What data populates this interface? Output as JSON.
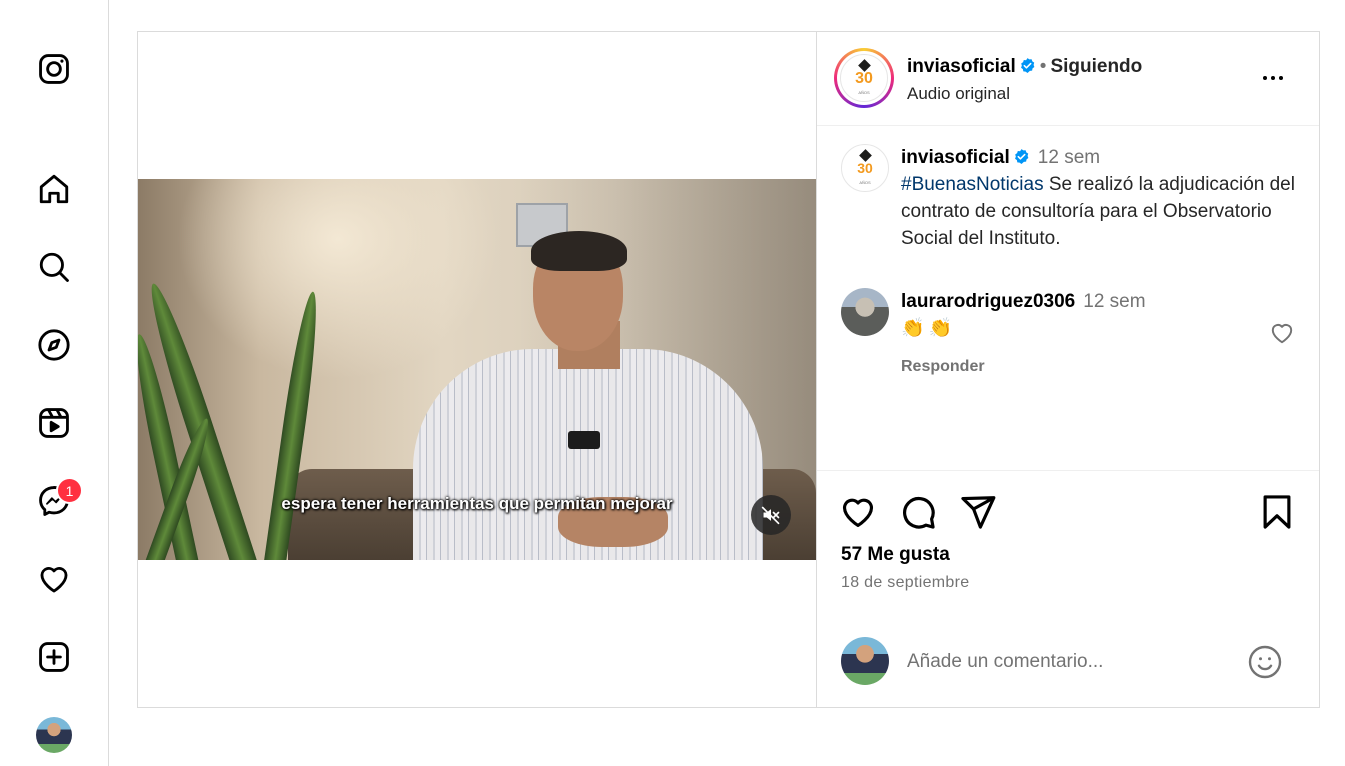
{
  "nav": {
    "items": [
      {
        "name": "instagram-logo-icon"
      },
      {
        "name": "home-icon"
      },
      {
        "name": "search-icon"
      },
      {
        "name": "explore-icon"
      },
      {
        "name": "reels-icon"
      },
      {
        "name": "messenger-icon"
      },
      {
        "name": "heart-icon"
      },
      {
        "name": "create-icon"
      }
    ],
    "messages_badge": "1"
  },
  "video": {
    "subtitle": "espera tener herramientas que permitan mejorar",
    "muted": true
  },
  "header": {
    "username": "inviasoficial",
    "separator": "•",
    "follow_label": "Siguiendo",
    "audio": "Audio original"
  },
  "logo": {
    "number": "30",
    "text": "AÑOS"
  },
  "caption": {
    "username": "inviasoficial",
    "time": "12 sem",
    "hashtag": "#BuenasNoticias",
    "text": " Se realizó la adjudicación del contrato de consultoría para el Observatorio Social del Instituto."
  },
  "comment": {
    "username": "laurarodriguez0306",
    "time": "12 sem",
    "text": "👏👏",
    "reply_label": "Responder"
  },
  "stats": {
    "likes": "57 Me gusta",
    "date": "18 de septiembre"
  },
  "add_comment": {
    "placeholder": "Añade un comentario..."
  },
  "colors": {
    "link": "#00376b",
    "verified": "#0095f6",
    "badge": "#ff3040",
    "muted_text": "#737373"
  }
}
